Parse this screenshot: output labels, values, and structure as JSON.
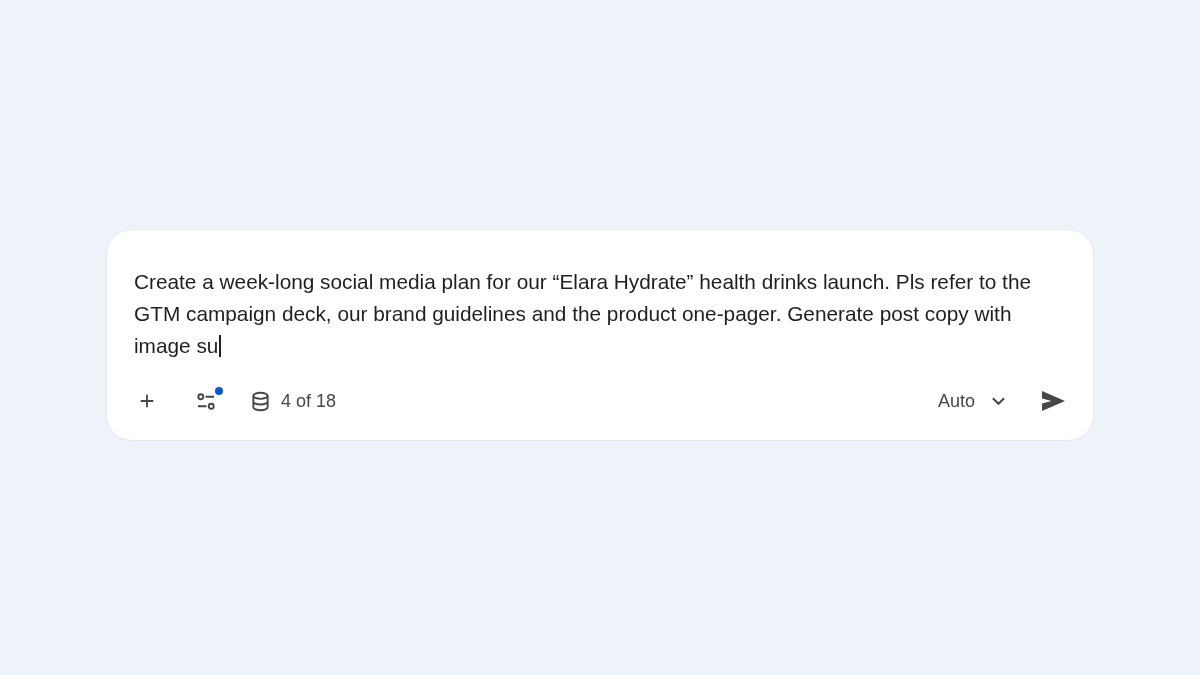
{
  "prompt": {
    "value": "Create a week-long social media plan for our “Elara Hydrate” health drinks launch. Pls refer to the GTM campaign deck, our brand guidelines and the product one-pager. Generate post copy with image su",
    "focused": true
  },
  "toolbar": {
    "tools_indicator": true,
    "sources_count": "4 of 18",
    "model": "Auto"
  }
}
